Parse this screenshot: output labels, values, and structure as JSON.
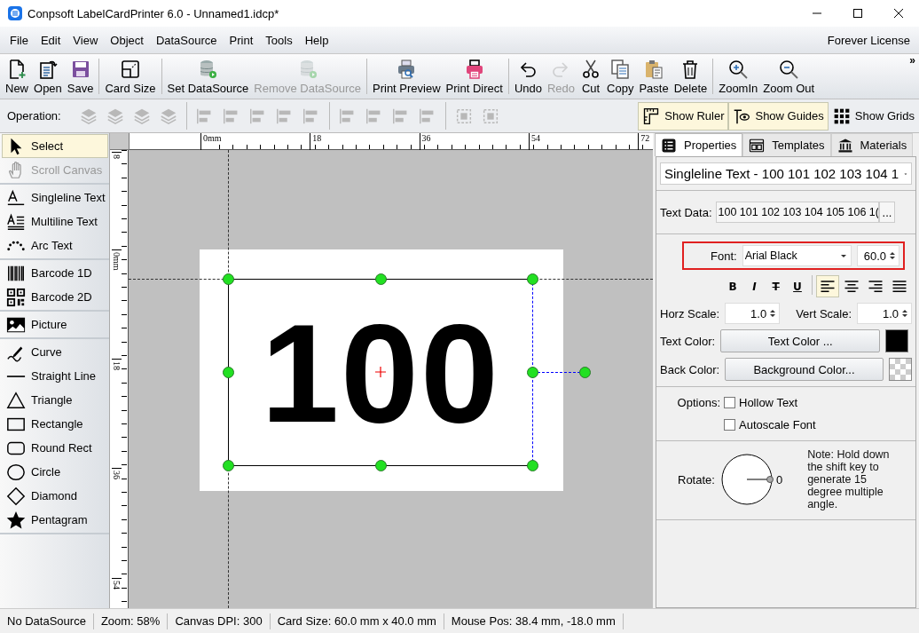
{
  "window": {
    "title": "Conpsoft LabelCardPrinter 6.0 - Unnamed1.idcp*"
  },
  "menu": {
    "items": [
      "File",
      "Edit",
      "View",
      "Object",
      "DataSource",
      "Print",
      "Tools",
      "Help"
    ],
    "license": "Forever License"
  },
  "toolbar": {
    "groups": [
      [
        {
          "label": "New",
          "disabled": false
        },
        {
          "label": "Open",
          "disabled": false
        },
        {
          "label": "Save",
          "disabled": false
        }
      ],
      [
        {
          "label": "Card Size",
          "disabled": false
        }
      ],
      [
        {
          "label": "Set DataSource",
          "disabled": false
        },
        {
          "label": "Remove DataSource",
          "disabled": true
        }
      ],
      [
        {
          "label": "Print Preview",
          "disabled": false
        },
        {
          "label": "Print Direct",
          "disabled": false
        }
      ],
      [
        {
          "label": "Undo",
          "disabled": false
        },
        {
          "label": "Redo",
          "disabled": true
        },
        {
          "label": "Cut",
          "disabled": false
        },
        {
          "label": "Copy",
          "disabled": false
        },
        {
          "label": "Paste",
          "disabled": false
        },
        {
          "label": "Delete",
          "disabled": false
        }
      ],
      [
        {
          "label": "ZoomIn",
          "disabled": false
        },
        {
          "label": "Zoom Out",
          "disabled": false
        }
      ]
    ],
    "overflow": "»"
  },
  "operation_bar": {
    "label": "Operation:",
    "tools_disabled": true,
    "toggles": [
      {
        "label": "Show Ruler",
        "selected": true
      },
      {
        "label": "Show Guides",
        "selected": true
      },
      {
        "label": "Show Grids",
        "selected": false
      }
    ]
  },
  "tool_palette": {
    "groups": [
      [
        {
          "label": "Select",
          "selected": true,
          "disabled": false
        },
        {
          "label": "Scroll Canvas",
          "selected": false,
          "disabled": true
        }
      ],
      [
        {
          "label": "Singleline Text",
          "selected": false,
          "disabled": false
        },
        {
          "label": "Multiline Text",
          "selected": false,
          "disabled": false
        },
        {
          "label": "Arc Text",
          "selected": false,
          "disabled": false
        }
      ],
      [
        {
          "label": "Barcode 1D",
          "selected": false,
          "disabled": false
        },
        {
          "label": "Barcode 2D",
          "selected": false,
          "disabled": false
        }
      ],
      [
        {
          "label": "Picture",
          "selected": false,
          "disabled": false
        }
      ],
      [
        {
          "label": "Curve",
          "selected": false,
          "disabled": false
        },
        {
          "label": "Straight Line",
          "selected": false,
          "disabled": false
        },
        {
          "label": "Triangle",
          "selected": false,
          "disabled": false
        },
        {
          "label": "Rectangle",
          "selected": false,
          "disabled": false
        },
        {
          "label": "Round Rect",
          "selected": false,
          "disabled": false
        },
        {
          "label": "Circle",
          "selected": false,
          "disabled": false
        },
        {
          "label": "Diamond",
          "selected": false,
          "disabled": false
        },
        {
          "label": "Pentagram",
          "selected": false,
          "disabled": false
        }
      ]
    ]
  },
  "canvas": {
    "top_ruler": [
      "0mm",
      "18",
      "36",
      "54",
      "72"
    ],
    "left_ruler": [
      "8",
      "0mm",
      "18",
      "36",
      "54"
    ],
    "label_text": "100"
  },
  "properties": {
    "tabs": [
      {
        "label": "Properties",
        "selected": true
      },
      {
        "label": "Templates",
        "selected": false
      },
      {
        "label": "Materials",
        "selected": false
      }
    ],
    "object_selector": "Singleline Text - 100 101 102 103 104 1",
    "text_data": {
      "label": "Text Data:",
      "value": "100 101 102 103 104 105 106 1(",
      "button": "..."
    },
    "font": {
      "label": "Font:",
      "value": "Arial Black",
      "size": "60.0"
    },
    "styles": [
      "B",
      "I",
      "T",
      "U"
    ],
    "align": [
      {
        "selected": true
      },
      {
        "selected": false
      },
      {
        "selected": false
      },
      {
        "selected": false
      }
    ],
    "horz_scale": {
      "label": "Horz Scale:",
      "value": "1.0"
    },
    "vert_scale": {
      "label": "Vert Scale:",
      "value": "1.0"
    },
    "text_color": {
      "label": "Text Color:",
      "button": "Text Color ...",
      "color": "#000000"
    },
    "back_color": {
      "label": "Back Color:",
      "button": "Background Color..."
    },
    "options": {
      "label": "Options:",
      "items": [
        {
          "label": "Hollow Text",
          "checked": false
        },
        {
          "label": "Autoscale Font",
          "checked": false
        }
      ]
    },
    "rotate": {
      "label": "Rotate:",
      "angle": "0",
      "note": "Note: Hold down the shift key to generate 15 degree multiple angle."
    }
  },
  "status_bar": [
    "No DataSource",
    "Zoom: 58%",
    "Canvas DPI: 300",
    "Card Size: 60.0 mm x 40.0 mm",
    "Mouse Pos: 38.4 mm, -18.0 mm"
  ]
}
